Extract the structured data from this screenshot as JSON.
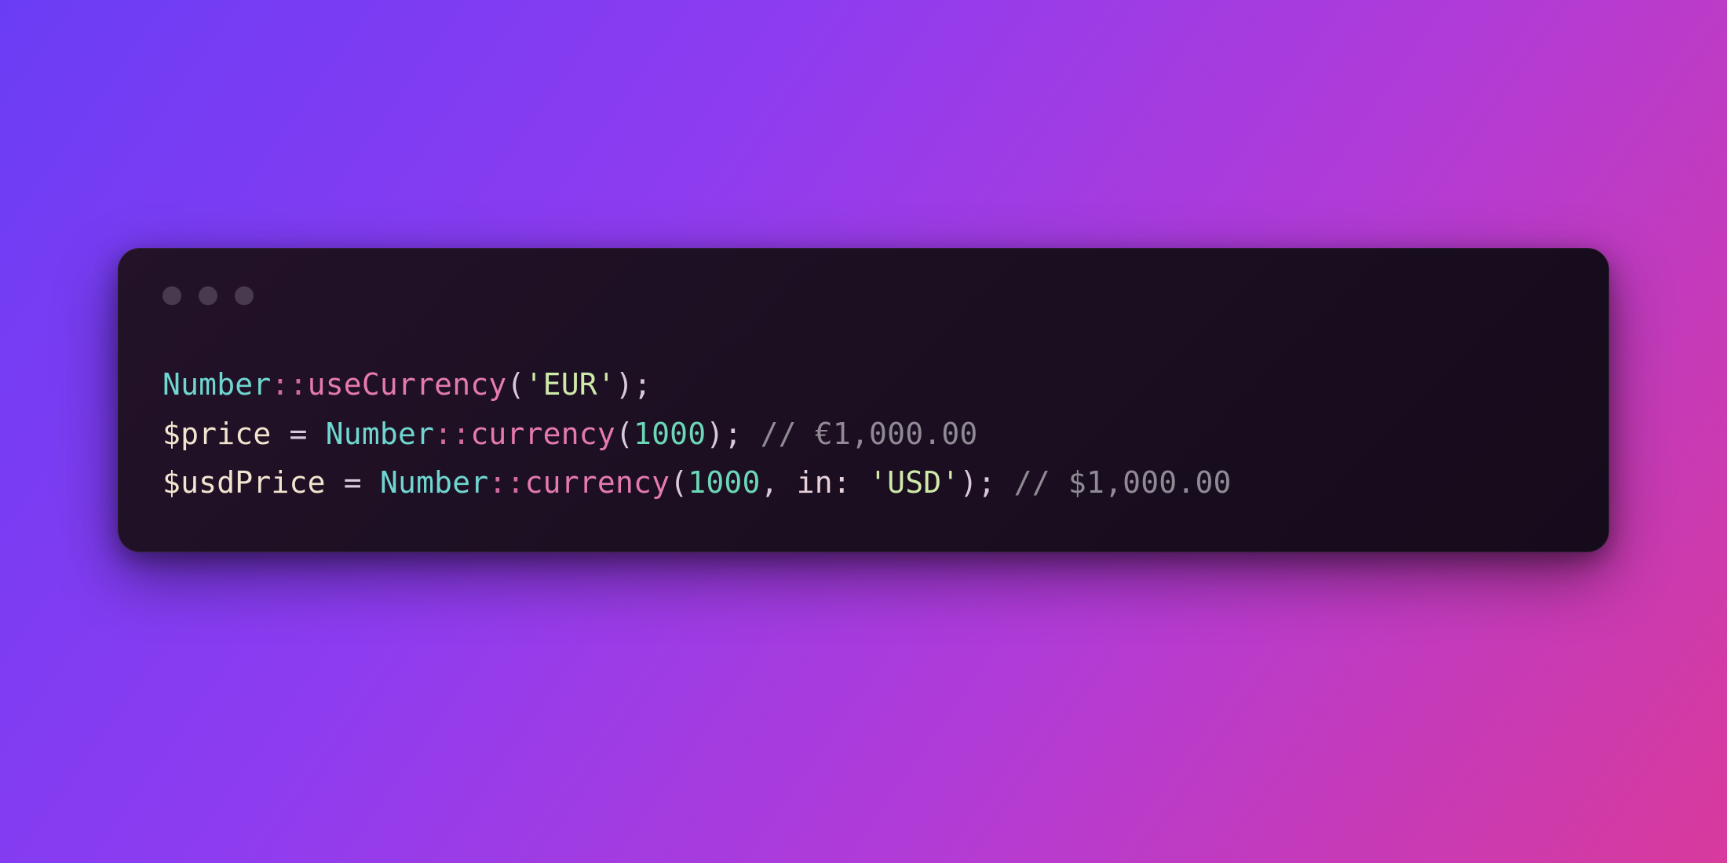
{
  "code": {
    "lines": [
      {
        "tokens": [
          {
            "cls": "tok-class",
            "text": "Number"
          },
          {
            "cls": "tok-scope",
            "text": "::"
          },
          {
            "cls": "tok-method",
            "text": "useCurrency"
          },
          {
            "cls": "tok-paren",
            "text": "("
          },
          {
            "cls": "tok-string",
            "text": "'EUR'"
          },
          {
            "cls": "tok-paren",
            "text": ")"
          },
          {
            "cls": "tok-punct",
            "text": ";"
          }
        ]
      },
      {
        "tokens": [
          {
            "cls": "tok-var",
            "text": "$price"
          },
          {
            "cls": "tok-op",
            "text": " = "
          },
          {
            "cls": "tok-class",
            "text": "Number"
          },
          {
            "cls": "tok-scope",
            "text": "::"
          },
          {
            "cls": "tok-method",
            "text": "currency"
          },
          {
            "cls": "tok-paren",
            "text": "("
          },
          {
            "cls": "tok-number",
            "text": "1000"
          },
          {
            "cls": "tok-paren",
            "text": ")"
          },
          {
            "cls": "tok-punct",
            "text": "; "
          },
          {
            "cls": "tok-comment",
            "text": "// €1,000.00"
          }
        ]
      },
      {
        "tokens": [
          {
            "cls": "tok-var",
            "text": "$usdPrice"
          },
          {
            "cls": "tok-op",
            "text": " = "
          },
          {
            "cls": "tok-class",
            "text": "Number"
          },
          {
            "cls": "tok-scope",
            "text": "::"
          },
          {
            "cls": "tok-method",
            "text": "currency"
          },
          {
            "cls": "tok-paren",
            "text": "("
          },
          {
            "cls": "tok-number",
            "text": "1000"
          },
          {
            "cls": "tok-punct",
            "text": ", "
          },
          {
            "cls": "tok-named",
            "text": "in: "
          },
          {
            "cls": "tok-string",
            "text": "'USD'"
          },
          {
            "cls": "tok-paren",
            "text": ")"
          },
          {
            "cls": "tok-punct",
            "text": "; "
          },
          {
            "cls": "tok-comment",
            "text": "// $1,000.00"
          }
        ]
      }
    ]
  }
}
